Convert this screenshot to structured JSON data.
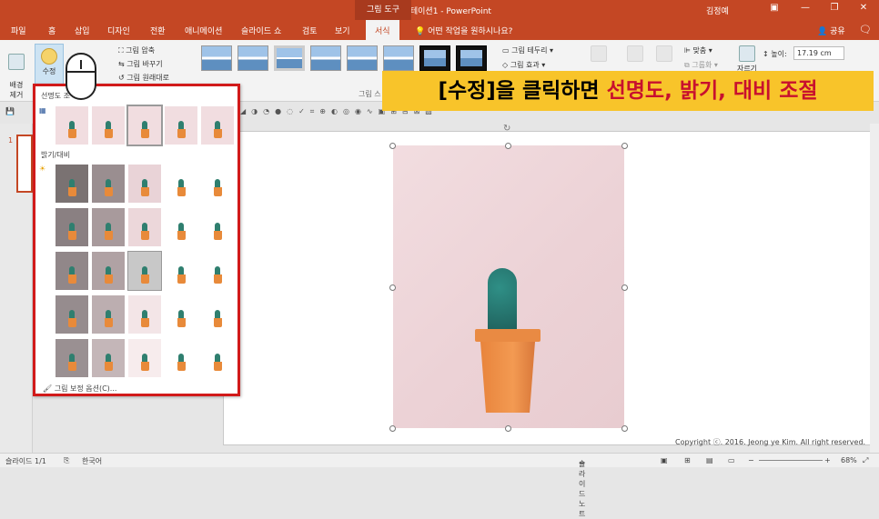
{
  "title_bar": {
    "title": "프레젠테이션1 - PowerPoint",
    "tool_tab": "그림 도구",
    "user": "김정예",
    "buttons": [
      "▣",
      "—",
      "❐",
      "✕"
    ]
  },
  "tabs": [
    "파일",
    "홈",
    "삽입",
    "디자인",
    "전환",
    "애니메이션",
    "슬라이드 쇼",
    "검토",
    "보기",
    "서식"
  ],
  "active_tab": "서식",
  "help_search": "어떤 작업을 원하시나요?",
  "share": "공유",
  "ribbon": {
    "remove_bg": "배경\n제거",
    "corrections": "수정",
    "compress": "그림 압축",
    "change": "그림 바꾸기",
    "reset": "그림 원래대로",
    "picture_border": "그림 테두리",
    "picture_effects": "그림 효과",
    "styles_group": "그림 스",
    "align": "맞춤",
    "group": "그룹화",
    "crop": "자르기",
    "height_label": "높이:",
    "height_value": "17.19 cm"
  },
  "dropdown": {
    "sharpness_title": "선명도 조",
    "brightness_title": "밝기/대비",
    "options": "그림 보정 옵션(C)..."
  },
  "banner": {
    "prefix": "[수정]을 클릭하면 ",
    "highlight": "선명도, 밝기, 대비 조절"
  },
  "slide_number": "1",
  "copyright": "Copyright ⓒ. 2016. Jeong ye Kim. All right reserved.",
  "status": {
    "slide": "슬라이드 1/1",
    "lang": "한국어",
    "notes": "슬라이드 노트",
    "zoom": "68%"
  }
}
